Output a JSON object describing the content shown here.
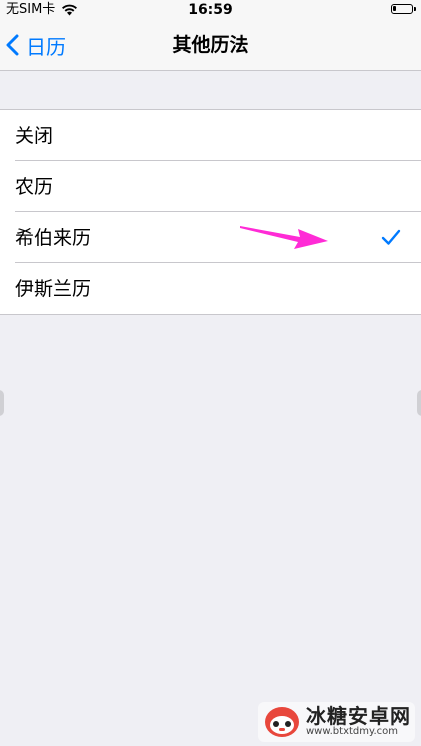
{
  "status_bar": {
    "carrier": "无SIM卡",
    "time": "16:59",
    "battery_level": 0.2
  },
  "nav": {
    "back_label": "日历",
    "title": "其他历法"
  },
  "options": [
    {
      "label": "关闭",
      "selected": false
    },
    {
      "label": "农历",
      "selected": false
    },
    {
      "label": "希伯来历",
      "selected": true
    },
    {
      "label": "伊斯兰历",
      "selected": false
    }
  ],
  "colors": {
    "accent": "#007aff",
    "background": "#efeff4",
    "annotation_arrow": "#ff2bd6"
  },
  "watermark": {
    "title": "冰糖安卓网",
    "url": "www.btxtdmy.com"
  }
}
